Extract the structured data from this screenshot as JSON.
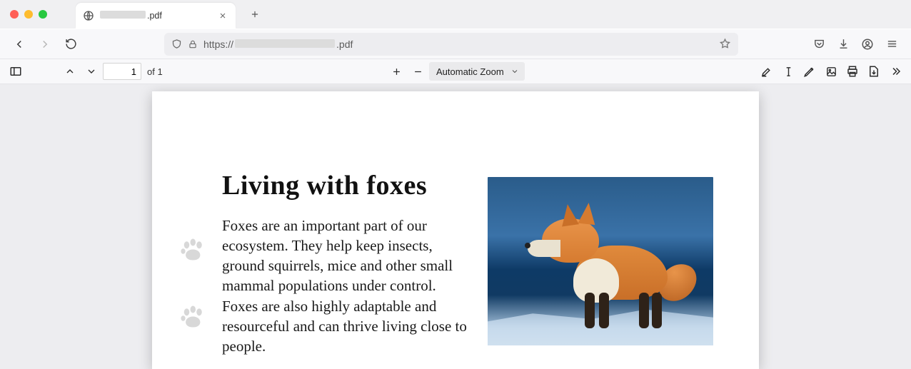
{
  "window": {
    "tab_suffix": ".pdf"
  },
  "nav": {
    "url_prefix": "https://",
    "url_suffix": ".pdf"
  },
  "pdfbar": {
    "page_current": "1",
    "page_total": "of 1",
    "zoom_label": "Automatic Zoom"
  },
  "document": {
    "title": "Living with foxes",
    "paragraph": "Foxes are an important part of our ecosystem. They help keep insects, ground squirrels, mice and other small mammal populations under control. Foxes are also highly adaptable and resourceful and can thrive living close to people.",
    "image_alt": "Red fox standing on snow"
  }
}
